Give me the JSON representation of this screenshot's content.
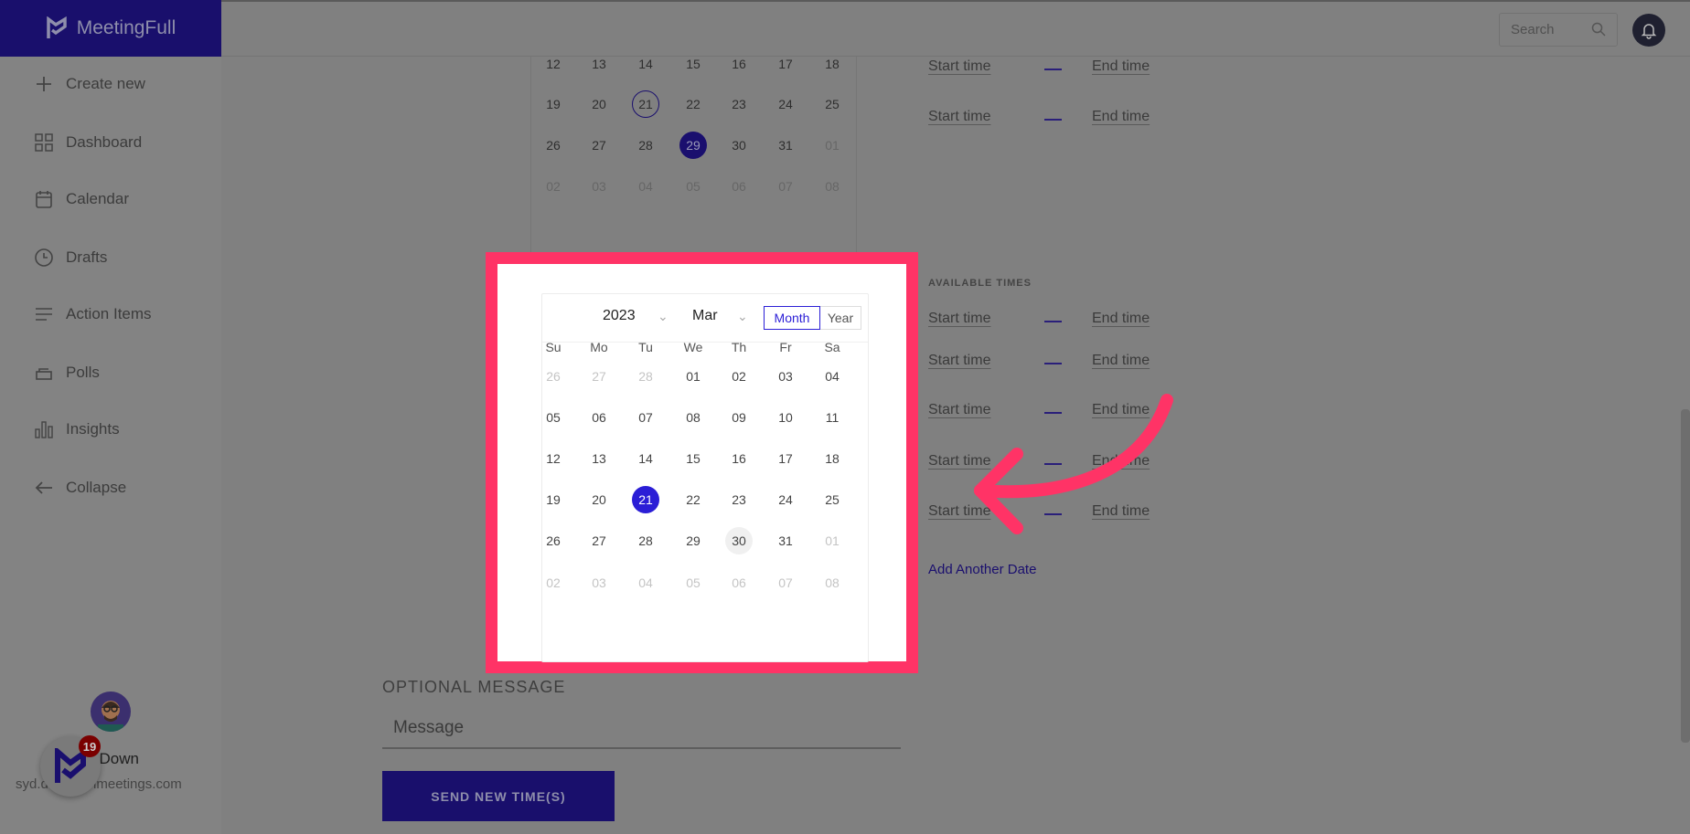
{
  "app": {
    "name": "MeetingFull"
  },
  "header": {
    "search_placeholder": "Search"
  },
  "sidebar": {
    "items": [
      {
        "label": "Create new",
        "icon": "plus-icon"
      },
      {
        "label": "Dashboard",
        "icon": "grid-icon"
      },
      {
        "label": "Calendar",
        "icon": "calendar-icon"
      },
      {
        "label": "Drafts",
        "icon": "clock-icon"
      },
      {
        "label": "Action Items",
        "icon": "list-icon"
      },
      {
        "label": "Polls",
        "icon": "poll-icon"
      },
      {
        "label": "Insights",
        "icon": "bar-chart-icon"
      },
      {
        "label": "Collapse",
        "icon": "arrow-left-icon"
      }
    ],
    "user": {
      "name": "l Down",
      "email": "syd.d…moonmeetings.com"
    },
    "widget_badge": "19"
  },
  "background_calendar": {
    "weeks": [
      [
        "12",
        "13",
        "14",
        "15",
        "16",
        "17",
        "18"
      ],
      [
        "19",
        "20",
        "21",
        "22",
        "23",
        "24",
        "25"
      ],
      [
        "26",
        "27",
        "28",
        "29",
        "30",
        "31",
        "01"
      ],
      [
        "02",
        "03",
        "04",
        "05",
        "06",
        "07",
        "08"
      ]
    ],
    "outlined": "21",
    "selected": "29"
  },
  "times_top": [
    {
      "start": "Start time",
      "end": "End time"
    },
    {
      "start": "Start time",
      "end": "End time"
    }
  ],
  "available_times": {
    "label": "AVAILABLE TIMES",
    "rows": [
      {
        "start": "Start time",
        "end": "End time"
      },
      {
        "start": "Start time",
        "end": "End time"
      },
      {
        "start": "Start time",
        "end": "End time"
      },
      {
        "start": "Start time",
        "end": "End time"
      },
      {
        "start": "Start time",
        "end": "End time"
      }
    ],
    "add_label": "Add Another Date"
  },
  "popup_calendar": {
    "year": "2023",
    "month": "Mar",
    "modes": [
      "Month",
      "Year"
    ],
    "active_mode": "Month",
    "weekdays": [
      "Su",
      "Mo",
      "Tu",
      "We",
      "Th",
      "Fr",
      "Sa"
    ],
    "weeks": [
      [
        "26",
        "27",
        "28",
        "01",
        "02",
        "03",
        "04"
      ],
      [
        "05",
        "06",
        "07",
        "08",
        "09",
        "10",
        "11"
      ],
      [
        "12",
        "13",
        "14",
        "15",
        "16",
        "17",
        "18"
      ],
      [
        "19",
        "20",
        "21",
        "22",
        "23",
        "24",
        "25"
      ],
      [
        "26",
        "27",
        "28",
        "29",
        "30",
        "31",
        "01"
      ],
      [
        "02",
        "03",
        "04",
        "05",
        "06",
        "07",
        "08"
      ]
    ],
    "selected": "21",
    "hovered": "30"
  },
  "message": {
    "label": "OPTIONAL MESSAGE",
    "placeholder": "Message"
  },
  "send_button": "SEND NEW TIME(S)",
  "colors": {
    "brand": "#1a0f6e",
    "accent": "#2b1ed6",
    "highlight": "#ff3366"
  }
}
